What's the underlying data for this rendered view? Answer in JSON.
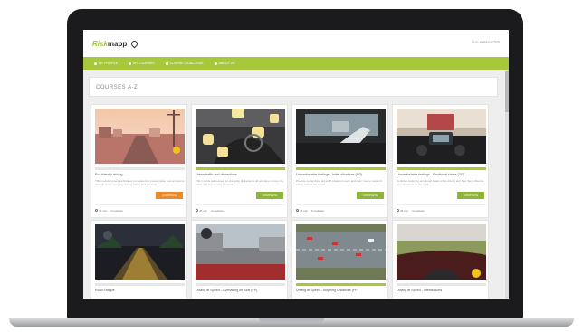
{
  "header": {
    "logo_part1": "Risk",
    "logo_part2": "mapp",
    "login_link": "LOG IN/REGISTER"
  },
  "nav": {
    "items": [
      {
        "label": "MY PROFILE"
      },
      {
        "label": "MY COURSES"
      },
      {
        "label": "COURSE CATALOGUE"
      },
      {
        "label": "ABOUT US"
      }
    ]
  },
  "page": {
    "section_title": "COURSES A-Z"
  },
  "courses": [
    {
      "title": "Eco-friendly driving",
      "description": "This module covers techniques to reduce fuel consumption and emissions through smart everyday driving habits and planning.",
      "button": "CONTINUE",
      "progress": 0,
      "meta_time": "75 min",
      "meta_modules": "4 modules"
    },
    {
      "title": "Urban traffic and distractions",
      "description": "This module addresses the everyday distractions drivers face in busy city traffic and how to stay focused.",
      "button": "COMPLETE",
      "progress": 1.0,
      "meta_time": "45 min",
      "meta_modules": "4 modules"
    },
    {
      "title": "Uncomfortable feelings - Initial situations (1/2)",
      "description": "Practice recognizing stressful situations early and learn how to respond calmly behind the wheel.",
      "button": "COMPLETE",
      "progress": 1.0,
      "meta_time": "45 min",
      "meta_modules": "5 modules"
    },
    {
      "title": "Uncomfortable feelings - Emotional states (2/2)",
      "description": "Continue exploring emotional states while driving and how they influence your decisions on the road.",
      "button": "COMPLETE",
      "progress": 1.0,
      "meta_time": "45 min",
      "meta_modules": "4 modules"
    },
    {
      "title": "Road Fatigue",
      "progress": 0
    },
    {
      "title": "Driving at Speed - Overtaking on rural (FP)",
      "progress": 0
    },
    {
      "title": "Driving at Speed - Stopping Distances (FP)",
      "progress": 1.0
    },
    {
      "title": "Driving at Speed - Intersections",
      "progress": 0
    }
  ],
  "colors": {
    "brand_green": "#a6c83a",
    "accent_orange": "#e98a2d",
    "button_green": "#8fb43a"
  }
}
